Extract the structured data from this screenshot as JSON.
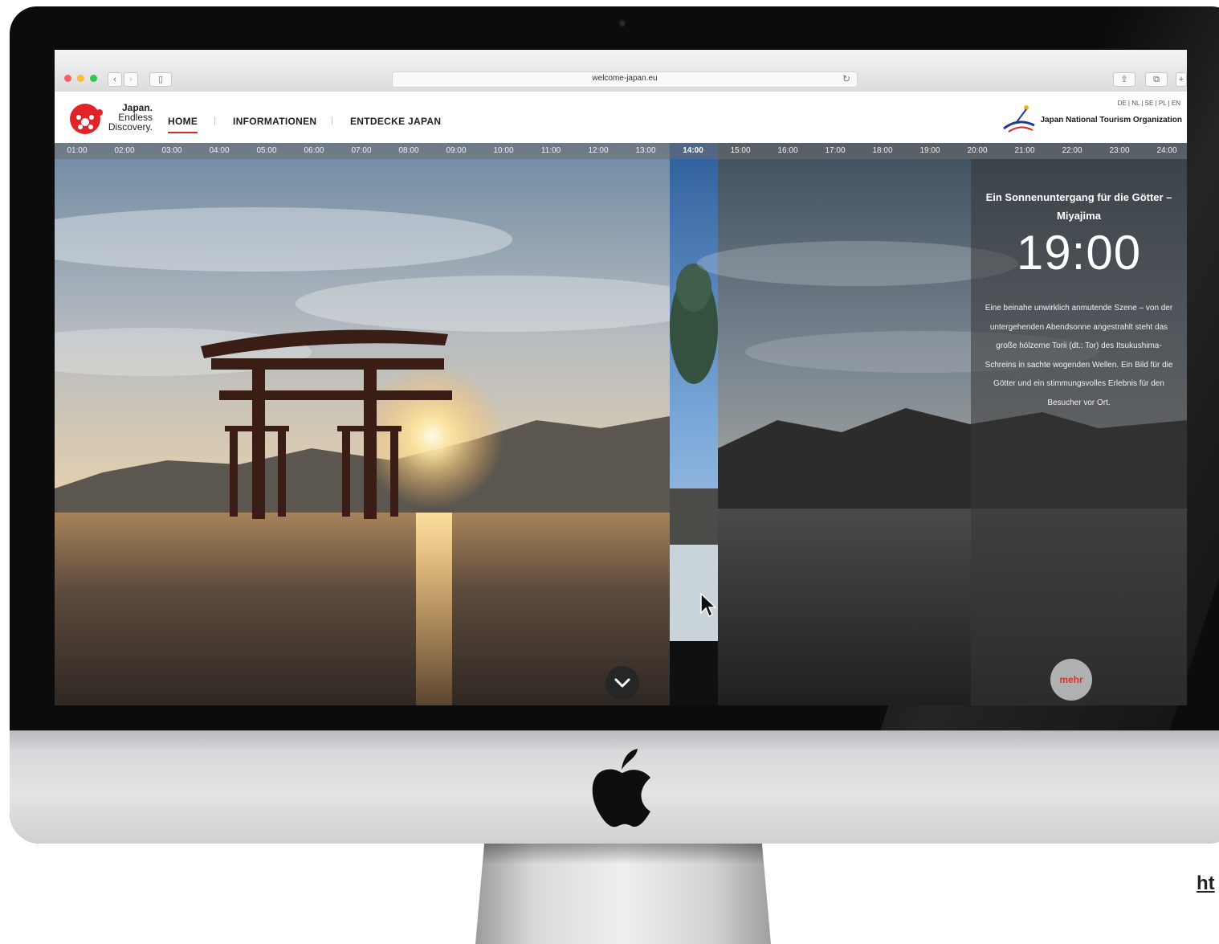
{
  "browser": {
    "url": "welcome-japan.eu"
  },
  "site": {
    "logo": {
      "line1": "Japan.",
      "line2": "Endless",
      "line3": "Discovery."
    },
    "nav": [
      {
        "label": "HOME",
        "active": true
      },
      {
        "label": "INFORMATIONEN",
        "active": false
      },
      {
        "label": "ENTDECKE JAPAN",
        "active": false
      }
    ],
    "languages": "DE | NL | SE | PL | EN",
    "organization": "Japan National Tourism Organization"
  },
  "timeline": {
    "hours": [
      "01:00",
      "02:00",
      "03:00",
      "04:00",
      "05:00",
      "06:00",
      "07:00",
      "08:00",
      "09:00",
      "10:00",
      "11:00",
      "12:00",
      "13:00",
      "14:00",
      "15:00",
      "16:00",
      "17:00",
      "18:00",
      "19:00",
      "20:00",
      "21:00",
      "22:00",
      "23:00",
      "24:00"
    ],
    "active": "14:00"
  },
  "info": {
    "title": "Ein Sonnenuntergang für die Götter – Miyajima",
    "time": "19:00",
    "description": "Eine beinahe unwirklich anmutende Szene – von der untergehenden Abendsonne angestrahlt steht das große hölzerne Torii (dt.: Tor) des Itsukushima-Schreins in sachte wogenden Wellen. Ein Bild für die Götter und ein stimmungsvolles Erlebnis für den Besucher vor Ort.",
    "more_label": "mehr"
  },
  "page_link_fragment": "ht"
}
